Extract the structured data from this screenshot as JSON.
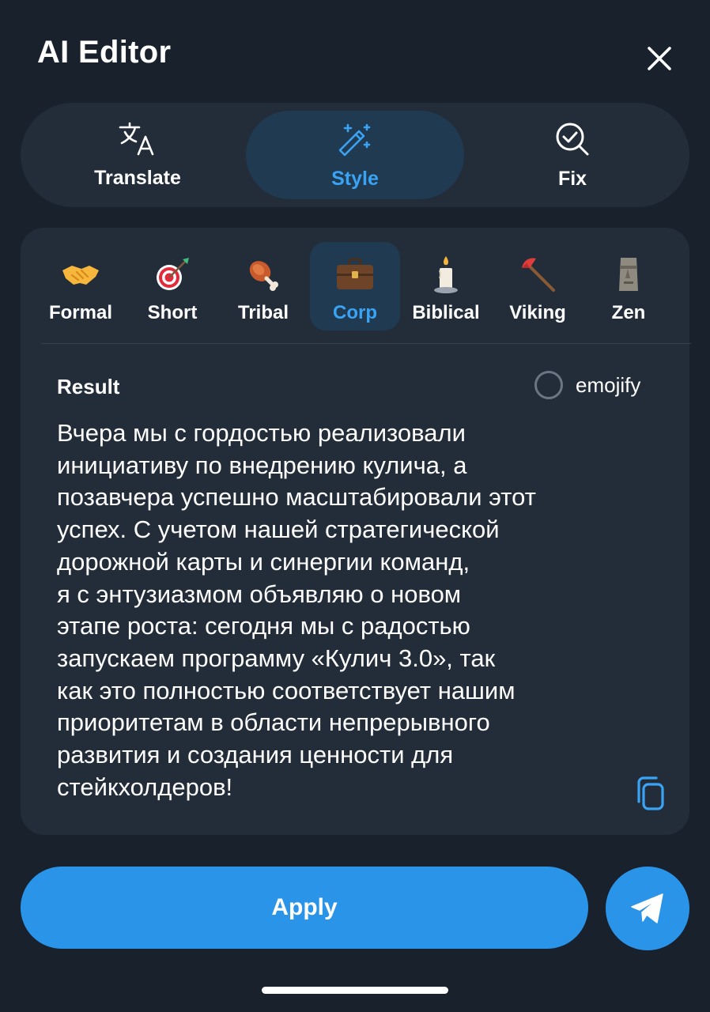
{
  "header": {
    "title": "AI Editor"
  },
  "modes": [
    {
      "label": "Translate",
      "icon": "translate-icon"
    },
    {
      "label": "Style",
      "icon": "magic-wand-icon",
      "active": true
    },
    {
      "label": "Fix",
      "icon": "magnifier-check-icon"
    }
  ],
  "styles": [
    {
      "label": "Formal",
      "icon": "handshake-icon"
    },
    {
      "label": "Short",
      "icon": "target-icon"
    },
    {
      "label": "Tribal",
      "icon": "meat-on-bone-icon"
    },
    {
      "label": "Corp",
      "icon": "briefcase-icon",
      "active": true
    },
    {
      "label": "Biblical",
      "icon": "candle-icon"
    },
    {
      "label": "Viking",
      "icon": "axe-icon"
    },
    {
      "label": "Zen",
      "icon": "moai-icon"
    }
  ],
  "result": {
    "label": "Result",
    "emojify_label": "emojify",
    "emojify_checked": false,
    "text_lines": [
      "Вчера мы с гордостью реализовали",
      "инициативу по внедрению кулича, а",
      "позавчера успешно масштабировали этот",
      "успех. С учетом нашей стратегической",
      "дорожной карты и синергии команд,",
      "я с энтузиазмом объявляю о новом",
      "этапе роста: сегодня мы с радостью",
      "запускаем программу «Кулич 3.0», так",
      "как это полностью соответствует нашим",
      "приоритетам в области непрерывного",
      "развития и создания ценности для",
      "стейкхолдеров!"
    ]
  },
  "actions": {
    "apply_label": "Apply",
    "send_icon": "send-plane-icon"
  },
  "colors": {
    "accent": "#2a94e9",
    "active_tab_bg": "#203a52",
    "background": "#18212c",
    "card": "#232d3a"
  }
}
